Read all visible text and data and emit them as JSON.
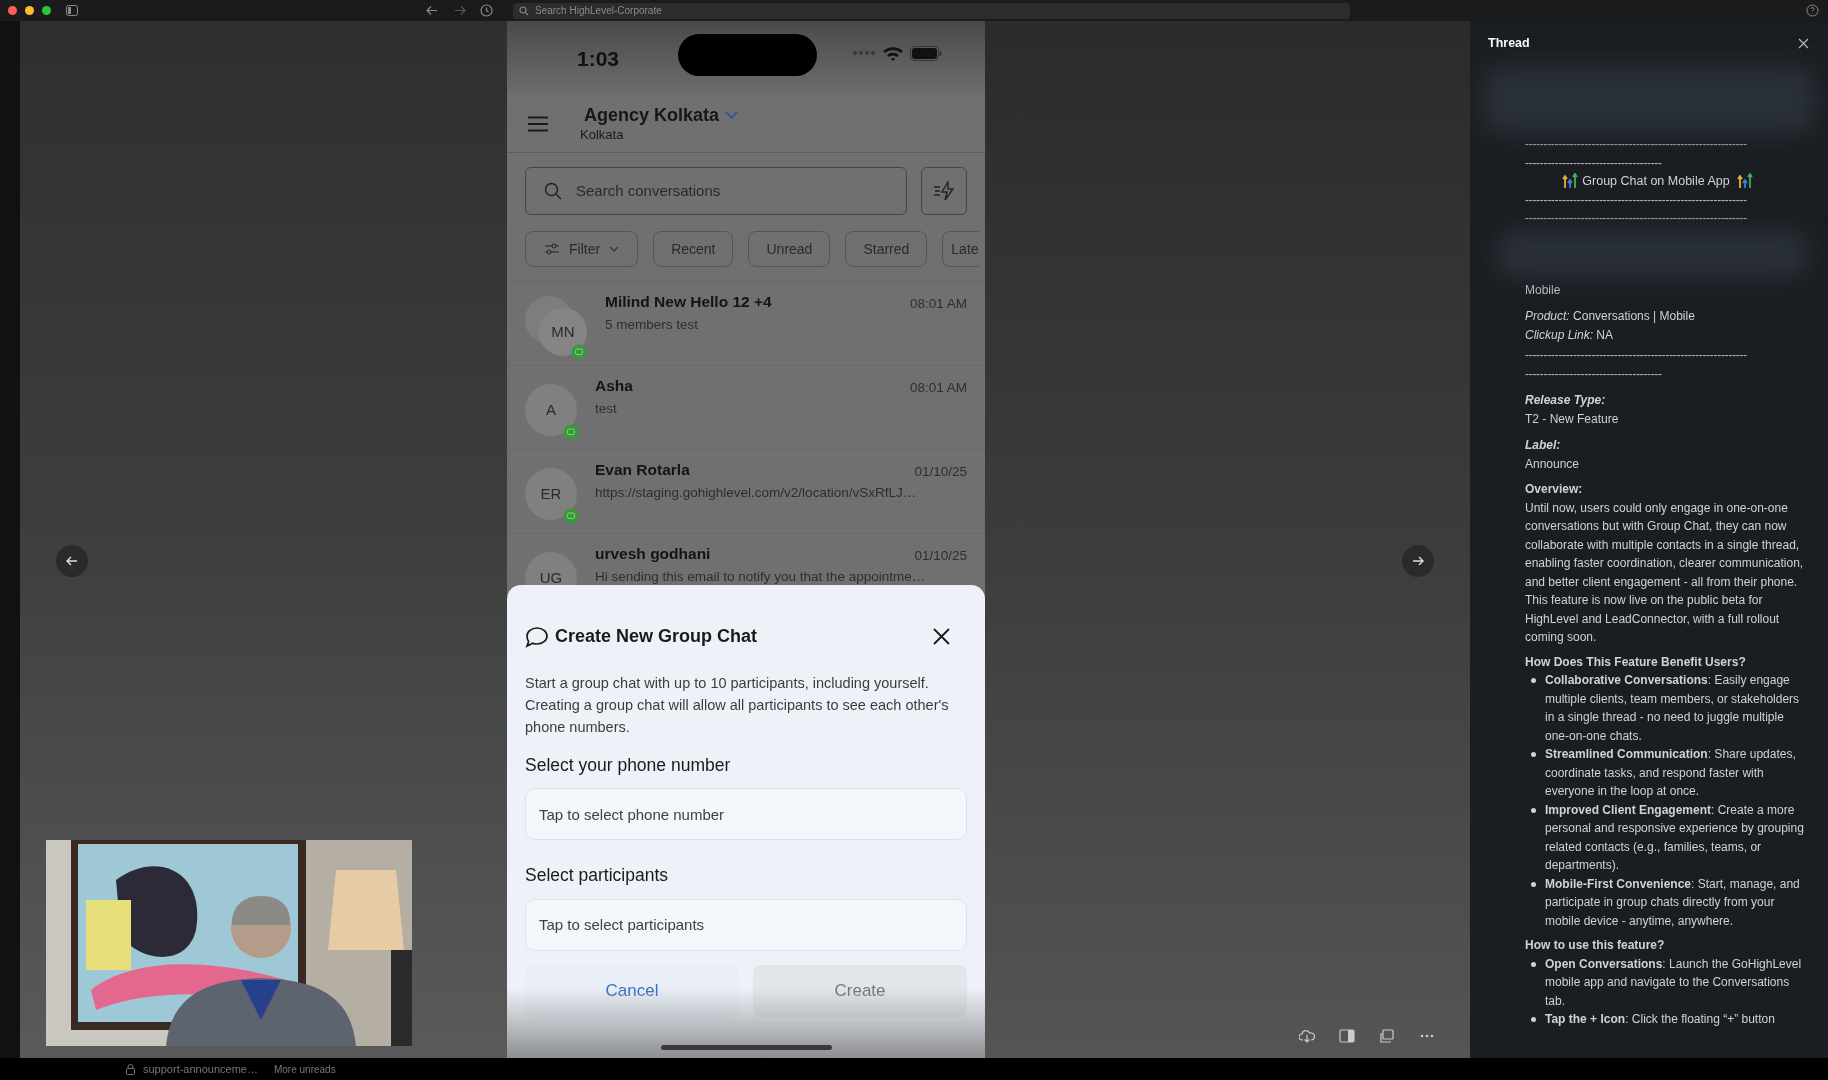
{
  "browser_bar": {
    "search_placeholder": "Search HighLevel-Corporate"
  },
  "phone": {
    "status_time": "1:03",
    "account": {
      "name": "Agency Kolkata",
      "location": "Kolkata"
    },
    "search": {
      "placeholder": "Search conversations"
    },
    "chips": [
      {
        "label": "Filter",
        "kind": "dropdown"
      },
      {
        "label": "Recent",
        "kind": "chip"
      },
      {
        "label": "Unread",
        "kind": "chip"
      },
      {
        "label": "Starred",
        "kind": "chip"
      },
      {
        "label": "Late",
        "kind": "edge"
      }
    ],
    "conversations": [
      {
        "kind": "group",
        "badge": true,
        "initials": "MN",
        "name": "Milind New Hello 12 +4",
        "preview": "5 members test",
        "time": "08:01 AM"
      },
      {
        "kind": "single",
        "badge": true,
        "initials": "A",
        "name": "Asha",
        "preview": "test",
        "time": "08:01 AM"
      },
      {
        "kind": "single",
        "badge": true,
        "initials": "ER",
        "name": "Evan Rotarla",
        "preview": "https://staging.gohighlevel.com/v2/location/vSxRfLJ…",
        "time": "01/10/25"
      },
      {
        "kind": "single",
        "badge": false,
        "initials": "UG",
        "name": "urvesh godhani",
        "preview": "Hi sending this email to notify you that the appointme…",
        "time": "01/10/25"
      }
    ],
    "dialog": {
      "title": "Create New Group Chat",
      "description": "Start a group chat with up to 10 participants, including yourself. Creating a group chat will allow all participants to see each other's phone numbers.",
      "fields": [
        {
          "label": "Select your phone number",
          "placeholder": "Tap to select phone number"
        },
        {
          "label": "Select participants",
          "placeholder": "Tap to select participants"
        }
      ],
      "buttons": [
        {
          "label": "Cancel",
          "kind": "secondary",
          "disabled": false
        },
        {
          "label": "Create",
          "kind": "primary",
          "disabled": true
        }
      ]
    }
  },
  "thread": {
    "title": "Thread",
    "top_rules": [
      "------------------------------------------------------------",
      "-------------------------------------"
    ],
    "banner": "Group Chat on Mobile App",
    "bottom_rules": [
      "------------------------------------------------------------",
      "------------------------------------------------------------"
    ],
    "blocks": [
      {
        "kind": "text",
        "text": "Mobile"
      },
      {
        "kind": "text",
        "text": "*Product:* Conversations | Mobile"
      },
      {
        "kind": "text",
        "text": "*Clickup Link:* NA"
      },
      {
        "kind": "rules",
        "lines": [
          "------------------------------------------------------------",
          "-------------------------------------"
        ]
      },
      {
        "kind": "field",
        "label": "Release Type:",
        "value": "T2 - New Feature"
      },
      {
        "kind": "field",
        "label": "Label:",
        "value": "Announce"
      },
      {
        "kind": "section",
        "heading": "Overview:",
        "paragraphs": [
          "Until now, users could only engage in one-on-one conversations but with Group Chat, they can now collaborate with multiple contacts in a single thread, enabling faster coordination, clearer communication, and better client engagement - all from their phone.",
          "This feature is now live on the public beta for HighLevel and LeadConnector, with a full rollout coming soon."
        ]
      },
      {
        "kind": "list",
        "heading": "How Does This Feature Benefit Users?",
        "bullets": [
          "**Collaborative Conversations**: Easily engage multiple clients, team members, or stakeholders in a single thread - no need to juggle multiple one-on-one chats.",
          "**Streamlined Communication**: Share updates, coordinate tasks, and respond faster with everyone in the loop at once.",
          "**Improved Client Engagement**: Create a more personal and responsive experience by grouping related contacts (e.g., families, teams, or departments).",
          "**Mobile-First Convenience**: Start, manage, and participate in group chats directly from your mobile device - anytime, anywhere."
        ]
      },
      {
        "kind": "list",
        "heading": "How to use this feature?",
        "bullets": [
          "**Open Conversations**: Launch the GoHighLevel mobile app and navigate to the Conversations tab.",
          "**Tap the + Icon**: Click the floating “+” button"
        ]
      }
    ]
  },
  "footer": {
    "channel": "support-announceme…",
    "unreads": "More unreads"
  }
}
